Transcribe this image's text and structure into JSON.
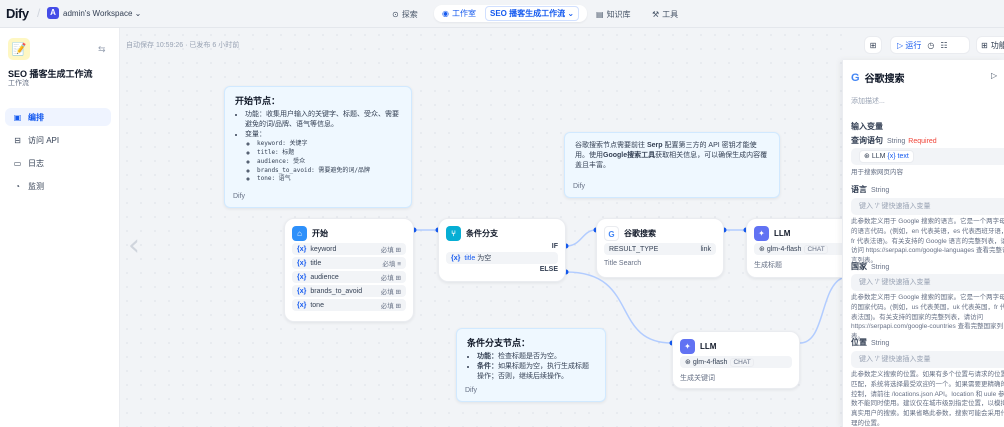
{
  "topbar": {
    "logo": "Dify",
    "workspace_initial": "A",
    "workspace_name": "admin's Workspace",
    "nav": [
      "探索",
      "工作室",
      "知识库",
      "工具"
    ],
    "current_workflow": "SEO 播客生成工作流"
  },
  "sidebar": {
    "app_title": "SEO 播客生成工作流",
    "app_type": "工作流",
    "items": [
      {
        "label": "编排",
        "icon": "layout-icon",
        "active": true
      },
      {
        "label": "访问 API",
        "icon": "api-icon",
        "active": false
      },
      {
        "label": "日志",
        "icon": "log-icon",
        "active": false
      },
      {
        "label": "监测",
        "icon": "monitor-icon",
        "active": false
      }
    ]
  },
  "canvas": {
    "autosave": "自动保存 10:59:26 · 已发布 6 小时前",
    "note1": {
      "title": "开始节点：",
      "items": [
        "功能：收集用户输入的关键字、标题、受众、需要避免的词/品牌、语气等信息。",
        "变量："
      ],
      "vars": [
        "keyword: 关键字",
        "title: 标题",
        "audience: 受众",
        "brands_to_avoid: 需要避免的词/品牌",
        "tone: 语气"
      ],
      "footer": "Dify"
    },
    "note2": {
      "text_a": "谷歌搜索节点需要前往 ",
      "text_b": "Serp",
      "text_c": " 配置第三方的 API 密钥才能使用。使用",
      "text_d": "Google搜索工具",
      "text_e": "获取相关信息，可以确保生成内容覆盖且丰富。",
      "footer": "Dify"
    },
    "note3": {
      "title": "条件分支节点：",
      "items": [
        {
          "k": "功能：",
          "v": "检查标题是否为空。"
        },
        {
          "k": "条件：",
          "v": "如果标题为空，执行生成标题操作；否则，继续后续操作。"
        }
      ],
      "footer": "Dify"
    },
    "start_node": {
      "title": "开始",
      "vars": [
        {
          "name": "keyword",
          "req": "必填"
        },
        {
          "name": "title",
          "req": "必填"
        },
        {
          "name": "audience",
          "req": "必填"
        },
        {
          "name": "brands_to_avoid",
          "req": "必填"
        },
        {
          "name": "tone",
          "req": "必填"
        }
      ]
    },
    "if_node": {
      "title": "条件分支",
      "if_label": "IF",
      "else_label": "ELSE",
      "cond_var": "title",
      "cond_op": "为空"
    },
    "google_node": {
      "title": "谷歌搜索",
      "param": "RESULT_TYPE",
      "param_val": "link",
      "desc": "Title Search"
    },
    "llm1": {
      "title": "LLM",
      "model": "glm-4-flash",
      "mode": "CHAT",
      "desc": "生成标题"
    },
    "llm2": {
      "title": "LLM",
      "model": "glm-4-flash",
      "mode": "CHAT",
      "desc": "生成关键词"
    }
  },
  "toolbar": {
    "run": "运行",
    "features": "功能"
  },
  "panel": {
    "title": "谷歌搜索",
    "desc_placeholder": "添加描述...",
    "section": "输入变量",
    "query": {
      "label": "查询语句",
      "type": "String",
      "required": "Required",
      "value_var": "LLM",
      "value_field": "text",
      "help": "用于搜索网页内容"
    },
    "language": {
      "label": "语言",
      "type": "String",
      "placeholder": "键入 '/' 键快速插入变量",
      "help": "此参数定义用于 Google 搜索的语言。它是一个两字母的语言代码。(例如，en 代表英语，es 代表西班牙语，fr 代表法语)。有关支持的 Google 语言的完整列表，请访问 https://serpapi.com/google-languages 查看完整语言列表。"
    },
    "country": {
      "label": "国家",
      "type": "String",
      "placeholder": "键入 '/' 键快速插入变量",
      "help": "此参数定义用于 Google 搜索的国家。它是一个两字母的国家代码。(例如，us 代表美国，uk 代表英国，fr 代表法国)。有关支持的国家的完整列表，请访问 https://serpapi.com/google-countries 查看完整国家列表。"
    },
    "location": {
      "label": "位置",
      "type": "String",
      "placeholder": "键入 '/' 键快速插入变量",
      "help": "此参数定义搜索的位置。如果有多个位置与请求的位置匹配，系统将选择最受欢迎的一个。如果需要更精确的控制，请前往 /locations.json API。location 和 uule 参数不能同时使用。建议仅在城市级别指定位置，以模拟真实用户的搜索。如果省略此参数，搜索可能会采用代理的位置。"
    }
  },
  "colors": {
    "accent": "#155aef",
    "start_icon": "#2e90fa",
    "if_icon": "#06aed4",
    "llm_icon": "#6172f3",
    "edge": "#b2ccff"
  }
}
